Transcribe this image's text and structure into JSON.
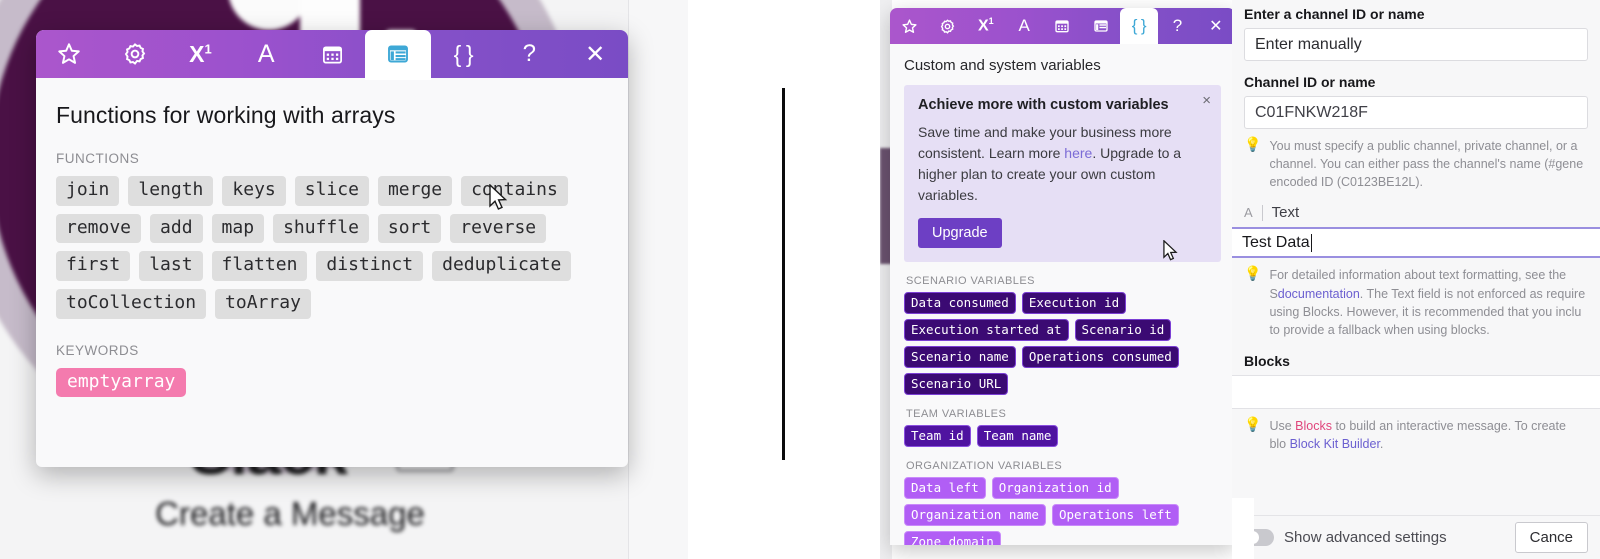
{
  "left_panel": {
    "backdrop": {
      "app_word": "Slack",
      "module_title": "Create a Message"
    },
    "toolbar": {
      "tabs": [
        {
          "name": "favorites",
          "glyph": "☆",
          "active": false
        },
        {
          "name": "general-functions",
          "glyph": "⚙",
          "active": false
        },
        {
          "name": "math-functions",
          "glyph": "X¹",
          "active": false
        },
        {
          "name": "text-functions",
          "glyph": "A",
          "active": false
        },
        {
          "name": "date-functions",
          "glyph": "Ὄ5",
          "active": false
        },
        {
          "name": "array-functions",
          "glyph": "▤",
          "active": true
        },
        {
          "name": "variables",
          "glyph": "{ }",
          "active": false
        },
        {
          "name": "help",
          "glyph": "?",
          "active": false
        },
        {
          "name": "close",
          "glyph": "✕",
          "active": false
        }
      ]
    },
    "heading": "Functions for working with arrays",
    "functions_label": "FUNCTIONS",
    "functions": [
      "join",
      "length",
      "keys",
      "slice",
      "merge",
      "contains",
      "remove",
      "add",
      "map",
      "shuffle",
      "sort",
      "reverse",
      "first",
      "last",
      "flatten",
      "distinct",
      "deduplicate",
      "toCollection",
      "toArray"
    ],
    "keywords_label": "KEYWORDS",
    "keywords": [
      "emptyarray"
    ]
  },
  "middle_panel": {
    "toolbar": {
      "tabs": [
        {
          "name": "favorites",
          "glyph": "☆",
          "active": false
        },
        {
          "name": "general-functions",
          "glyph": "⚙",
          "active": false
        },
        {
          "name": "math-functions",
          "glyph": "X¹",
          "active": false
        },
        {
          "name": "text-functions",
          "glyph": "A",
          "active": false
        },
        {
          "name": "date-functions",
          "glyph": "Ὄ5",
          "active": false
        },
        {
          "name": "array-functions",
          "glyph": "▤",
          "active": false
        },
        {
          "name": "variables",
          "glyph": "{ }",
          "active": true
        },
        {
          "name": "help",
          "glyph": "?",
          "active": false
        },
        {
          "name": "close",
          "glyph": "✕",
          "active": false
        }
      ]
    },
    "subheading": "Custom and system variables",
    "promo": {
      "title": "Achieve more with custom variables",
      "body_part1": "Save time and make your business more consistent. Learn more ",
      "link": "here",
      "body_part2": ". Upgrade to a higher plan to create your own custom variables.",
      "button": "Upgrade",
      "close_glyph": "×"
    },
    "groups": [
      {
        "label": "SCENARIO VARIABLES",
        "style": "scenario",
        "chips": [
          "Data consumed",
          "Execution id",
          "Execution started at",
          "Scenario id",
          "Scenario name",
          "Operations consumed",
          "Scenario URL"
        ]
      },
      {
        "label": "TEAM VARIABLES",
        "style": "team",
        "chips": [
          "Team id",
          "Team name"
        ]
      },
      {
        "label": "ORGANIZATION VARIABLES",
        "style": "org",
        "chips": [
          "Data left",
          "Organization id",
          "Organization name",
          "Operations left",
          "Zone domain"
        ]
      }
    ]
  },
  "right_panel": {
    "channel_mode_label": "Enter a channel ID or name",
    "channel_mode_value": "Enter manually",
    "channel_id_label": "Channel ID or name",
    "channel_id_value": "C01FNKW218F",
    "channel_hint": "You must specify a public channel, private channel, or a channel. You can either pass the channel's name (#gene encoded ID (C0123BE12L).",
    "text_field_icon_label": "A",
    "text_field_label": "Text",
    "text_field_value": "Test Data",
    "text_hint_part1": "For detailed information about text formatting, see the S",
    "text_hint_link": "documentation",
    "text_hint_part2": ". The Text field is not enforced as require using Blocks. However, it is recommended that you inclu to provide a fallback when using blocks.",
    "blocks_label": "Blocks",
    "blocks_value": "",
    "blocks_hint_part1": "Use ",
    "blocks_hint_link1": "Blocks",
    "blocks_hint_part2": " to build an interactive message. To create blo ",
    "blocks_hint_link2": "Block Kit Builder",
    "blocks_hint_part3": ".",
    "advanced_toggle_label": "Show advanced settings",
    "cancel_button": "Cance"
  },
  "colors": {
    "toolbar_gradient_start": "#ab56cc",
    "toolbar_gradient_end": "#7a4cc5",
    "active_tab_icon": "#3ea8d6",
    "keyword_chip": "#f47bae",
    "function_chip": "#dedede",
    "scenario_chip": "#3b0a73",
    "team_chip": "#4f13a0",
    "org_chip": "#b15ef5",
    "promo_bg": "#e6dff5",
    "upgrade_button": "#6d3fc4",
    "focus_underline": "#9a8fe0",
    "bulb_icon": "#f0b429"
  }
}
